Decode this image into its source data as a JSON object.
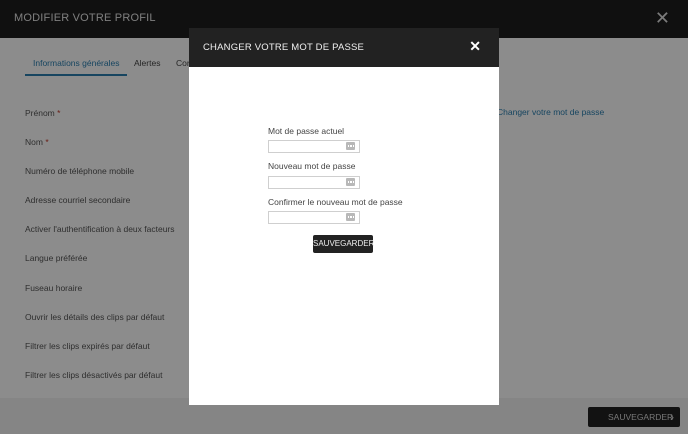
{
  "page": {
    "title": "MODIFIER VOTRE PROFIL",
    "close_glyph": "✕"
  },
  "tabs": [
    {
      "label": "Informations générales"
    },
    {
      "label": "Alertes"
    },
    {
      "label": "Cor"
    }
  ],
  "form": {
    "required_marker": "*",
    "fields": [
      {
        "label": "Prénom"
      },
      {
        "label": "Nom"
      },
      {
        "label": "Numéro de téléphone mobile"
      },
      {
        "label": "Adresse courriel secondaire"
      },
      {
        "label": "Activer l'authentification à deux facteurs"
      },
      {
        "label": "Langue préférée"
      },
      {
        "label": "Fuseau horaire"
      },
      {
        "label": "Ouvrir les détails des clips par défaut"
      },
      {
        "label": "Filtrer les clips expirés par défaut"
      },
      {
        "label": "Filtrer les clips désactivés par défaut"
      }
    ],
    "change_password_link": "Changer votre mot de passe"
  },
  "footer": {
    "save_label": "SAUVEGARDER",
    "chevron_glyph": "›"
  },
  "modal": {
    "title": "CHANGER VOTRE MOT DE PASSE",
    "close_glyph": "✕",
    "fields": [
      {
        "label": "Mot de passe actuel",
        "value": ""
      },
      {
        "label": "Nouveau mot de passe",
        "value": ""
      },
      {
        "label": "Confirmer le nouveau mot de passe",
        "value": ""
      }
    ],
    "save_label": "SAUVEGARDER"
  }
}
